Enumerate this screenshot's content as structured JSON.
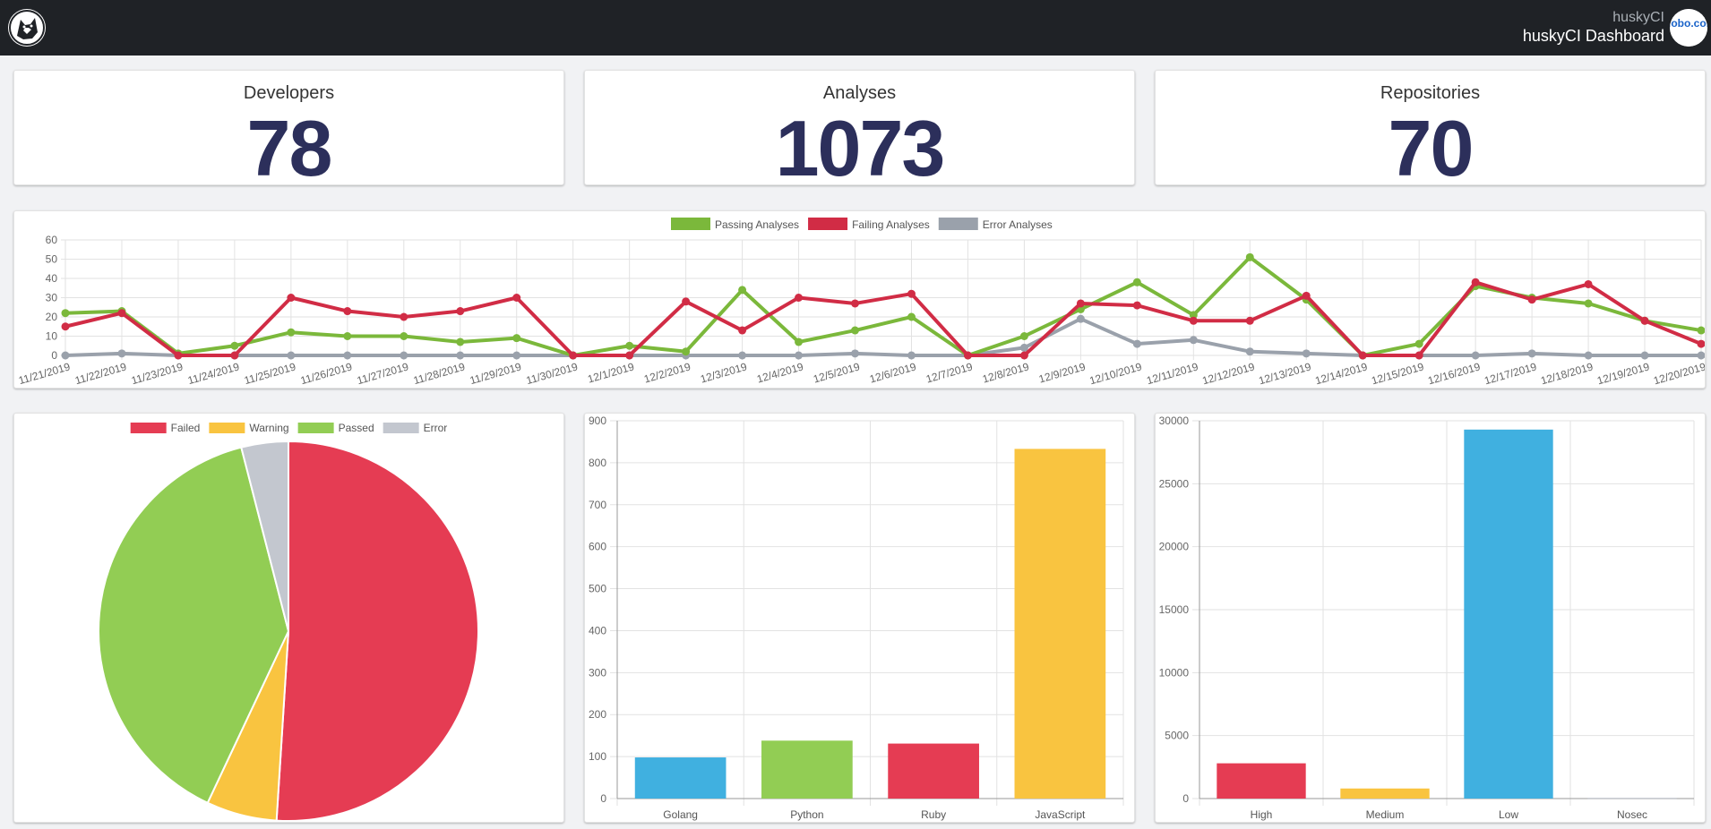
{
  "navbar": {
    "app_name": "huskyCI",
    "title": "huskyCI Dashboard",
    "partner_logo_text": "globo.com"
  },
  "stats": [
    {
      "title": "Developers",
      "value": "78"
    },
    {
      "title": "Analyses",
      "value": "1073"
    },
    {
      "title": "Repositories",
      "value": "70"
    }
  ],
  "colors": {
    "green": "#7bb83b",
    "red": "#d12c45",
    "gray": "#9aa1ab",
    "yellow": "#f9c440",
    "blue": "#40b0e0",
    "lightgreen": "#92cd54",
    "lightgray": "#c3c7cf",
    "pink": "#e53c53",
    "navy": "#2c2f5b"
  },
  "chart_data": [
    {
      "type": "line",
      "categories": [
        "11/21/2019",
        "11/22/2019",
        "11/23/2019",
        "11/24/2019",
        "11/25/2019",
        "11/26/2019",
        "11/27/2019",
        "11/28/2019",
        "11/29/2019",
        "11/30/2019",
        "12/1/2019",
        "12/2/2019",
        "12/3/2019",
        "12/4/2019",
        "12/5/2019",
        "12/6/2019",
        "12/7/2019",
        "12/8/2019",
        "12/9/2019",
        "12/10/2019",
        "12/11/2019",
        "12/12/2019",
        "12/13/2019",
        "12/14/2019",
        "12/15/2019",
        "12/16/2019",
        "12/17/2019",
        "12/18/2019",
        "12/19/2019",
        "12/20/2019"
      ],
      "ylim": [
        0,
        60
      ],
      "yticks": [
        0,
        10,
        20,
        30,
        40,
        50,
        60
      ],
      "legend_position": "top",
      "grid": true,
      "series": [
        {
          "name": "Passing Analyses",
          "color": "#7bb83b",
          "values": [
            22,
            23,
            1,
            5,
            12,
            10,
            10,
            7,
            9,
            0,
            5,
            2,
            34,
            7,
            13,
            20,
            0,
            10,
            24,
            38,
            21,
            51,
            29,
            0,
            6,
            36,
            30,
            27,
            18,
            13
          ]
        },
        {
          "name": "Failing Analyses",
          "color": "#d12c45",
          "values": [
            15,
            22,
            0,
            0,
            30,
            23,
            20,
            23,
            30,
            0,
            0,
            28,
            13,
            30,
            27,
            32,
            0,
            0,
            27,
            26,
            18,
            18,
            31,
            0,
            0,
            38,
            29,
            37,
            18,
            6
          ]
        },
        {
          "name": "Error Analyses",
          "color": "#9aa1ab",
          "values": [
            0,
            1,
            0,
            0,
            0,
            0,
            0,
            0,
            0,
            0,
            0,
            0,
            0,
            0,
            1,
            0,
            0,
            4,
            19,
            6,
            8,
            2,
            1,
            0,
            0,
            0,
            1,
            0,
            0,
            0
          ]
        }
      ]
    },
    {
      "type": "pie",
      "legend_position": "top",
      "labels": [
        "Failed",
        "Warning",
        "Passed",
        "Error"
      ],
      "colors": [
        "#e53c53",
        "#f9c440",
        "#92cd54",
        "#c3c7cf"
      ],
      "values": [
        51,
        6,
        39,
        4
      ]
    },
    {
      "type": "bar",
      "categories": [
        "Golang",
        "Python",
        "Ruby",
        "JavaScript"
      ],
      "colors": [
        "#40b0e0",
        "#92cd54",
        "#e53c53",
        "#f9c440"
      ],
      "values": [
        98,
        138,
        131,
        833
      ],
      "ylim": [
        0,
        900
      ],
      "yticks": [
        0,
        100,
        200,
        300,
        400,
        500,
        600,
        700,
        800,
        900
      ]
    },
    {
      "type": "bar",
      "categories": [
        "High",
        "Medium",
        "Low",
        "Nosec"
      ],
      "colors": [
        "#e53c53",
        "#f9c440",
        "#40b0e0",
        "#c3c7cf"
      ],
      "values": [
        2800,
        800,
        29300,
        60
      ],
      "ylim": [
        0,
        30000
      ],
      "yticks": [
        0,
        5000,
        10000,
        15000,
        20000,
        25000,
        30000
      ]
    }
  ]
}
